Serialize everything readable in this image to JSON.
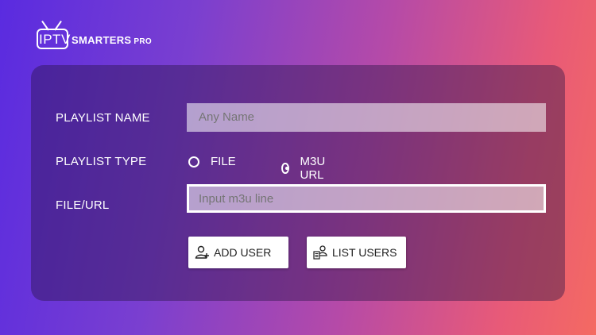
{
  "brand": {
    "iptv": "IPTV",
    "smarters": "SMARTERS",
    "pro": "PRO"
  },
  "form": {
    "playlist_name_label": "PLAYLIST NAME",
    "playlist_name_placeholder": "Any Name",
    "playlist_type_label": "PLAYLIST TYPE",
    "type_options": [
      {
        "label": "FILE",
        "selected": false
      },
      {
        "label": "M3U URL",
        "selected": true
      }
    ],
    "file_url_label": "FILE/URL",
    "file_url_placeholder": "Input m3u line"
  },
  "buttons": {
    "add_user": "ADD USER",
    "list_users": "LIST USERS"
  },
  "icons": {
    "logo": "tv-icon",
    "add_user": "add-user-icon",
    "list_users": "users-list-icon"
  }
}
